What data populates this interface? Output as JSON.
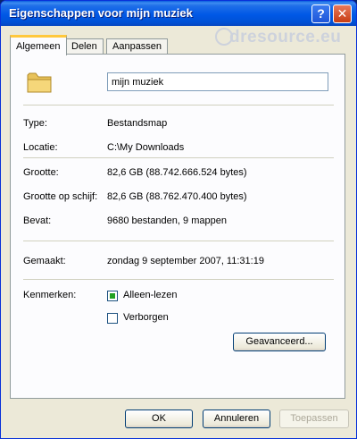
{
  "window": {
    "title": "Eigenschappen voor mijn muziek"
  },
  "watermark": {
    "text": "dresource.eu"
  },
  "titlebar_buttons": {
    "help": "?",
    "close": "✕"
  },
  "tabs": [
    {
      "label": "Algemeen",
      "active": true
    },
    {
      "label": "Delen",
      "active": false
    },
    {
      "label": "Aanpassen",
      "active": false
    }
  ],
  "general": {
    "folder_icon": "folder-icon",
    "name_value": "mijn muziek",
    "rows": [
      {
        "label": "Type:",
        "value": "Bestandsmap"
      },
      {
        "label": "Locatie:",
        "value": "C:\\My Downloads"
      },
      {
        "label": "Grootte:",
        "value": "82,6 GB (88.742.666.524 bytes)"
      },
      {
        "label": "Grootte op schijf:",
        "value": "82,6 GB (88.762.470.400 bytes)"
      },
      {
        "label": "Bevat:",
        "value": "9680  bestanden, 9 mappen"
      }
    ],
    "created": {
      "label": "Gemaakt:",
      "value": "zondag 9 september 2007, 11:31:19"
    },
    "attributes": {
      "label": "Kenmerken:",
      "readonly": {
        "label": "Alleen-lezen",
        "checked": true
      },
      "hidden": {
        "label": "Verborgen",
        "checked": false
      },
      "advanced_button": "Geavanceerd..."
    }
  },
  "footer": {
    "ok": "OK",
    "cancel": "Annuleren",
    "apply": "Toepassen"
  },
  "colors": {
    "titlebar": "#0058e6",
    "dialog_bg": "#ece9d8",
    "tab_highlight": "#ffc83c"
  }
}
